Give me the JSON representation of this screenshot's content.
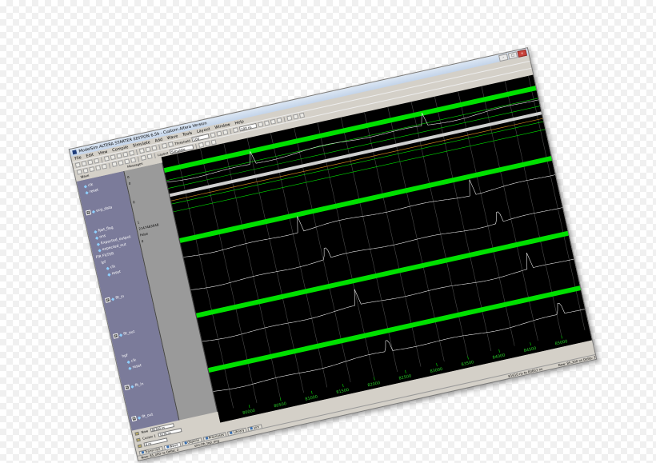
{
  "window": {
    "title": "ModelSim ALTERA STARTER EDITION 6.5b - Custom Altera Version"
  },
  "menu": [
    "File",
    "Edit",
    "View",
    "Compile",
    "Simulate",
    "Add",
    "Wave",
    "Tools",
    "Layout",
    "Window",
    "Help"
  ],
  "toolbar": {
    "threshold_label": "Threshold",
    "threshold_value": "100",
    "run_length": "100 ns",
    "layout_label": "Layout",
    "layout_value": "Simulate"
  },
  "wave": {
    "pane_title": "Wave",
    "messages_header": "Messages",
    "signals": [
      {
        "name": "clk",
        "indent": 1
      },
      {
        "name": "reset",
        "indent": 1
      },
      {
        "name": "ecg_data",
        "indent": 0,
        "group": true
      },
      {
        "name": "fpst_flag",
        "indent": 1
      },
      {
        "name": "ons",
        "indent": 1
      },
      {
        "name": "Expected_output",
        "indent": 1
      },
      {
        "name": "expected_out",
        "indent": 1
      },
      {
        "name": "FIR FILTER",
        "indent": 0
      },
      {
        "name": "lpf",
        "indent": 1
      },
      {
        "name": "clk",
        "indent": 2
      },
      {
        "name": "reset",
        "indent": 2
      },
      {
        "name": "flt_in",
        "indent": 1,
        "group": true
      },
      {
        "name": "flt_out",
        "indent": 1,
        "group": true
      },
      {
        "name": "hpf",
        "indent": 1
      },
      {
        "name": "clk",
        "indent": 2
      },
      {
        "name": "reset",
        "indent": 2
      },
      {
        "name": "flt_in",
        "indent": 1,
        "group": true
      },
      {
        "name": "flt_out",
        "indent": 1,
        "group": true
      }
    ],
    "values": [
      "0",
      "0",
      "0",
      "1",
      "2147483648",
      "False",
      "0"
    ],
    "timeline_ticks": [
      "80000",
      "80500",
      "81000",
      "81500",
      "82000",
      "82500",
      "83000",
      "83500",
      "84000",
      "84500",
      "85000"
    ],
    "now_label": "Now",
    "now_value": "85300 ns",
    "cursor_label": "Cursor 1",
    "cursor_value": "5578 ns",
    "cursor2_value": "0 ns"
  },
  "tabs": [
    "Transcript",
    "Wave",
    "Objects",
    "Processes",
    "Library",
    "sim"
  ],
  "status": {
    "now": "Now: 85,300 ns  Delta: 2",
    "sim": "sim:/tb_top_ecg",
    "range": "81610 ns to 83833 ns",
    "now2": "Now: 85,300 ns  Delta: 2"
  },
  "colors": {
    "wave_bg": "#000000",
    "bus": "#00e000",
    "analog": "#e8e8e8",
    "grid": "#4a4a4a",
    "name_pane": "#7b7b9a",
    "value_pane": "#9a9a9a",
    "orange_line": "#c8861e"
  }
}
